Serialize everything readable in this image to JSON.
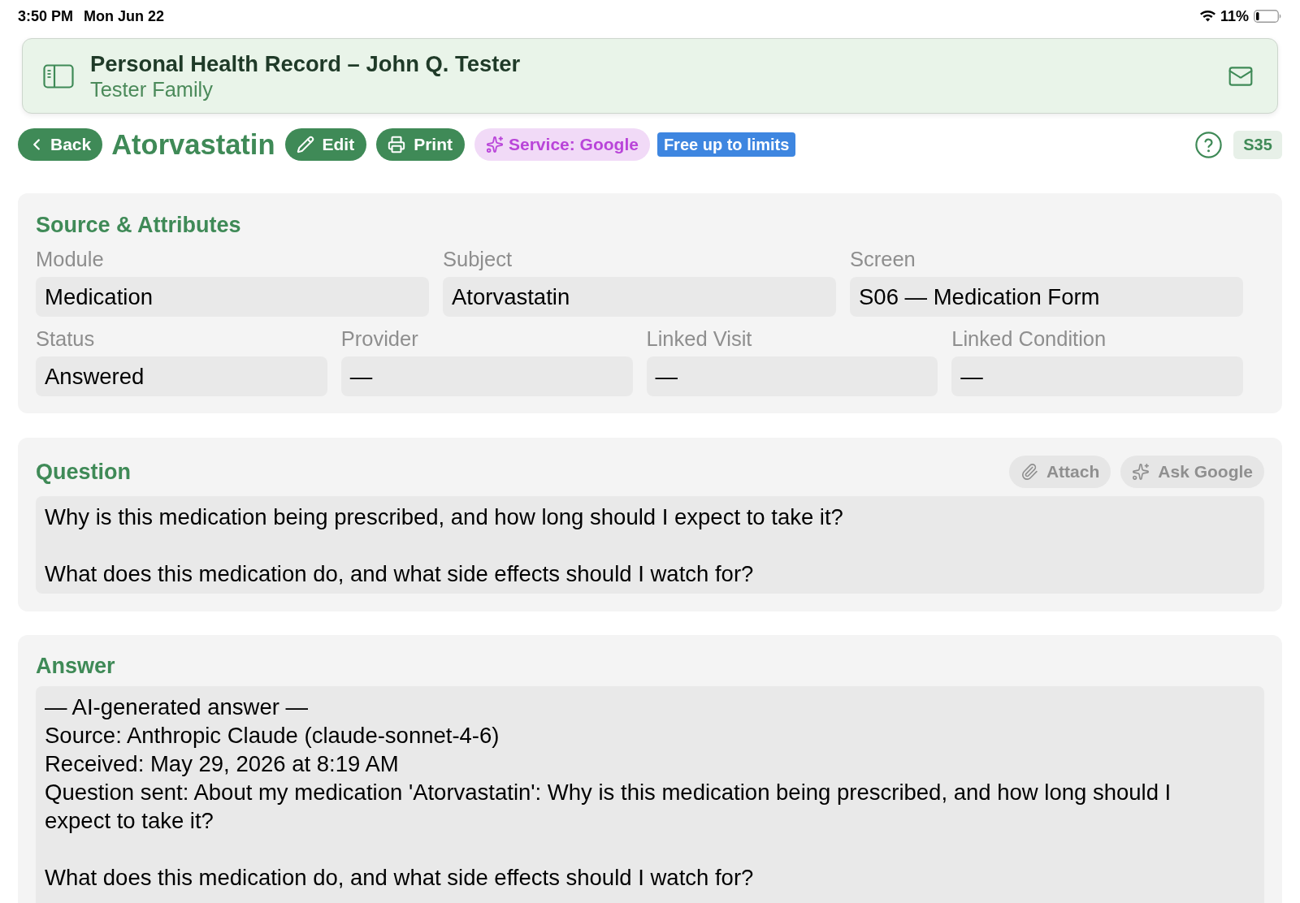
{
  "status_bar": {
    "time": "3:50 PM",
    "date": "Mon Jun 22",
    "battery_text": "11%"
  },
  "header": {
    "title": "Personal Health Record – John Q. Tester",
    "subtitle": "Tester Family"
  },
  "toolbar": {
    "back": "Back",
    "title": "Atorvastatin",
    "buttons": [
      {
        "label": "Edit",
        "kind": "edit"
      },
      {
        "label": "Print",
        "kind": "print"
      }
    ],
    "service": "Service: Google",
    "badge": "Free up to limits",
    "screen_code": "S35"
  },
  "source_attributes": {
    "title": "Source & Attributes",
    "groups": [
      {
        "fields": [
          {
            "label": "Module",
            "value": "Medication"
          },
          {
            "label": "Subject",
            "value": "Atorvastatin"
          },
          {
            "label": "Screen",
            "value": "S06 — Medication Form"
          }
        ]
      },
      {
        "fields": [
          {
            "label": "Status",
            "value": "Answered"
          },
          {
            "label": "Provider",
            "value": "—"
          },
          {
            "label": "Linked Visit",
            "value": "—"
          },
          {
            "label": "Linked Condition",
            "value": "—"
          }
        ]
      }
    ]
  },
  "question": {
    "title": "Question",
    "actions": [
      {
        "label": "Attach",
        "kind": "attach",
        "disabled": true
      },
      {
        "label": "Ask Google",
        "kind": "ask",
        "disabled": true
      }
    ],
    "text": "Why is this medication being prescribed, and how long should I expect to take it?\n\nWhat does this medication do, and what side effects should I watch for?"
  },
  "answer": {
    "title": "Answer",
    "text": "— AI-generated answer —\nSource: Anthropic Claude (claude-sonnet-4-6)\nReceived: May 29, 2026 at 8:19 AM\nQuestion sent: About my medication 'Atorvastatin': Why is this medication being prescribed, and how long should I expect to take it?\n\nWhat does this medication do, and what side effects should I watch for?"
  }
}
